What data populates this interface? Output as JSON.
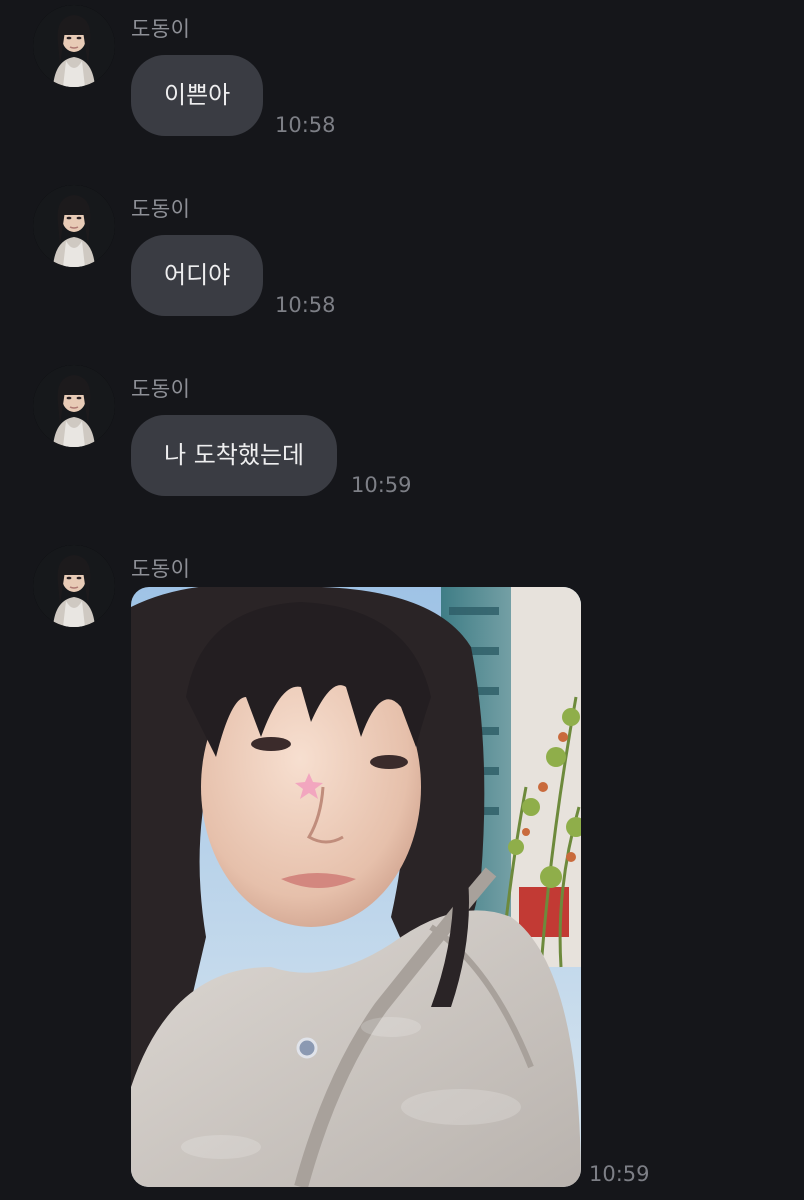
{
  "messages": [
    {
      "sender": "도동이",
      "text": "이쁜아",
      "time": "10:58"
    },
    {
      "sender": "도동이",
      "text": "어디야",
      "time": "10:58"
    },
    {
      "sender": "도동이",
      "text": "나 도착했는데",
      "time": "10:59"
    },
    {
      "sender": "도동이",
      "image": "selfie-photo",
      "time": "10:59"
    }
  ],
  "colors": {
    "background": "#15161a",
    "bubble": "#3a3c43",
    "bubble_text": "#eeeeef",
    "sender_text": "#8e9097",
    "time_text": "#7d7f86"
  }
}
